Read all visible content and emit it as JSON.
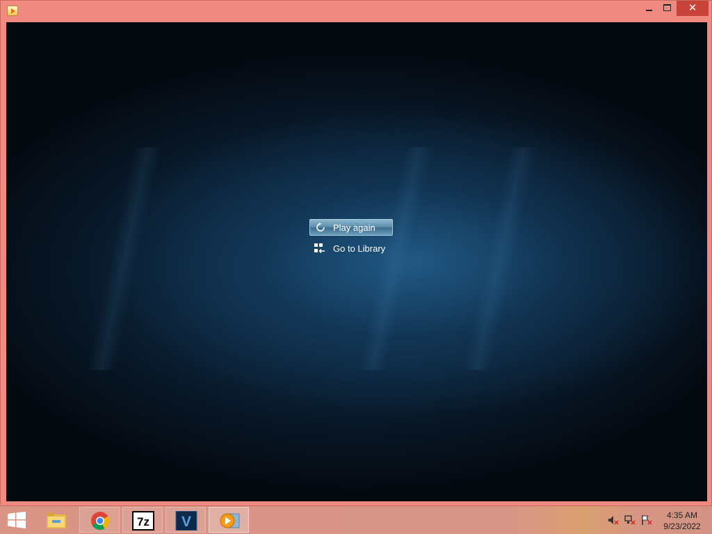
{
  "window": {
    "title": "",
    "controls": {
      "minimize": "",
      "maximize": "",
      "close": "✕"
    }
  },
  "player": {
    "play_again_label": "Play again",
    "go_to_library_label": "Go to Library"
  },
  "taskbar": {
    "items": [
      {
        "name": "file-explorer",
        "icon": "folder-icon"
      },
      {
        "name": "chrome",
        "icon": "chrome-icon"
      },
      {
        "name": "7zip",
        "icon": "7zip-icon",
        "label": "7z"
      },
      {
        "name": "veracrypt",
        "icon": "v-icon",
        "label": "V"
      },
      {
        "name": "media-player",
        "icon": "media-player-icon",
        "active": true
      }
    ],
    "tray": [
      "volume-muted-icon",
      "network-error-icon",
      "action-center-error-icon"
    ],
    "clock": {
      "time": "4:35 AM",
      "date": "9/23/2022"
    }
  },
  "colors": {
    "window_frame": "#f08a80",
    "close_button": "#c7433a",
    "video_bg_center": "#14385a",
    "video_bg_edge": "#03060a"
  }
}
